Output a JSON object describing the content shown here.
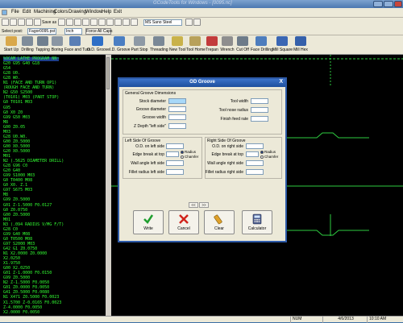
{
  "window": {
    "title": "GCodeTools for Windows - [0095.nc]"
  },
  "menu": [
    "File",
    "Edit",
    "Machining",
    "Colors",
    "Drawing",
    "Window",
    "Help",
    "Exit"
  ],
  "toolbar": {
    "save_label": "Save as",
    "material_value": "MS Sano Steel",
    "select_post_label": "Select post:",
    "post_value": "Fagor0095.pst",
    "units_value": "Inch",
    "force_all_caps_label": "Force All Caps",
    "tools": [
      "Start Up",
      "Drilling",
      "Tapping",
      "Boring",
      "Face and Turn",
      "O.D. Groove",
      "I.D. Groove",
      "Part Stop",
      "Threading",
      "New Tool",
      "Tool Home",
      "Trepan",
      "Wrench",
      "Cut Off",
      "Face Drilling",
      "Mill Square",
      "Mill Hex"
    ]
  },
  "editor": {
    "lines": [
      "%OCAM LATHE PROGRAM NN~",
      "G20 G95 G40 G18",
      "G54",
      "G28 U0.",
      "G28 W0.",
      "N1 (FACE AND TURN OP1)",
      "(ROUGH FACE AND TURN)",
      "N2 G50 S2500",
      "(T0101) M03 (PART STOP)",
      "G0 T0101 M03",
      "G95",
      "G0 X0 Z0",
      "G99 G50 M03",
      "M8",
      "G00 Z0.05",
      "M03",
      "G28 U0.W0.",
      "G00 Z0.5000",
      "G00 X0.5000",
      "G20 X0.5000",
      "M01",
      "N2 (.5625 DIAMETER DRILL)",
      "G28 G96 C0",
      "G20 G40",
      "G99 S1000 M03",
      "G0 T0400 M08",
      "G0 X0. Z.1",
      "G97 S675 M03",
      "M8",
      "G99 Z0.5000",
      "G01 Z-1.5000 F0.0127",
      "G0 Z0.0750",
      "G00 Z0.5000",
      "M01",
      "N3 (.094 RADIUS V/MG F/T)",
      "G28 C0",
      "G99 G40 M08",
      "G0 T0500 M08",
      "G97 S2000 M03",
      "G42 G1 Z0.0750",
      "N1 X2.0000 Z0.0000",
      "X2.0250",
      "X1.9750",
      "G00 X2.0250",
      "G01 Z-1.0000 F0.0150",
      "G99 Z0.5000",
      "N2 Z-1.5000 F0.0050",
      "G01 Z0.0000 F0.0050",
      "G41 Z0.5000 F0.0080",
      "N1 X471 Z0.5000 F0.0023",
      "X1.5700 Z-0.0165 F0.0023",
      "Z-4.0000 F0.0050",
      "X2.0000 F0.0050"
    ]
  },
  "dialog": {
    "title": "OD Groove",
    "close_label": "X",
    "general_title": "General Groove Dimensions",
    "general_left_labels": [
      "Stock diameter",
      "Groove diameter",
      "Groove width",
      "Z Depth \"left side\""
    ],
    "general_right_labels": [
      "Tool width",
      "Tool nose radius",
      "Finish feed rate"
    ],
    "left_title": "Left Side Of Groove",
    "right_title": "Right Side Of Groove",
    "left_labels": [
      "O.D. on left side",
      "Edge break at top",
      "Wall angle left side",
      "Fillet radius left side"
    ],
    "right_labels": [
      "O.D. on right side",
      "Edge break at top",
      "Wall angle right side",
      "Fillet radius right side"
    ],
    "radio_radius": "Radius",
    "radio_chamfer": "Chamfer",
    "pager": {
      "back": "<<",
      "next": ">>"
    },
    "buttons": [
      "Write",
      "Cancel",
      "Clear",
      "Calculator"
    ]
  },
  "status": {
    "num": "NUM",
    "date": "4/6/2013",
    "time": "10:10 AM"
  },
  "colors": {
    "editor_text": "#33ff33",
    "graph_line": "#2ecc40",
    "title": "#1e4f9e"
  }
}
